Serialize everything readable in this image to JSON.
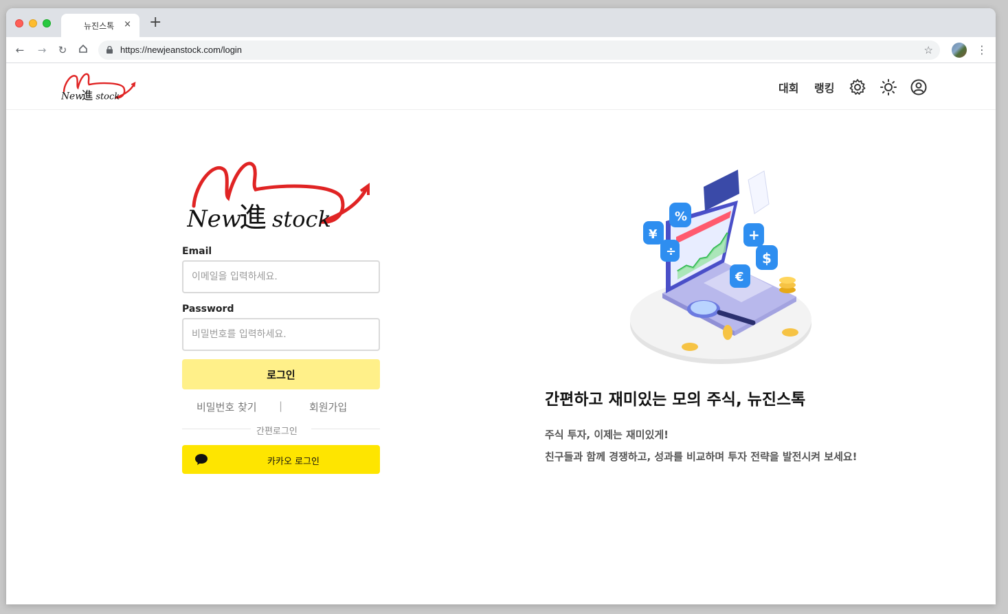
{
  "browser": {
    "tab_title": "뉴진스톡",
    "tab_close": "×",
    "new_tab": "+",
    "url": "https://newjeanstock.com/login"
  },
  "header": {
    "nav": [
      "대회",
      "랭킹"
    ],
    "icons": [
      "settings-icon",
      "theme-sun-icon",
      "account-icon"
    ]
  },
  "logo": {
    "text_new": "New",
    "text_hanja": "進",
    "text_stock": "stock"
  },
  "login": {
    "email_label": "Email",
    "email_placeholder": "이메일을 입력하세요.",
    "password_label": "Password",
    "password_placeholder": "비밀번호를 입력하세요.",
    "login_button": "로그인",
    "find_password": "비밀번호 찾기",
    "separator": "|",
    "signup": "회원가입",
    "easy_login": "간편로그인",
    "kakao_button": "카카오 로그인"
  },
  "hero": {
    "title": "간편하고 재미있는 모의 주식, 뉴진스톡",
    "desc_line1": "주식 투자, 이제는 재미있게!",
    "desc_line2": "친구들과 함께 경쟁하고, 성과를 비교하며 투자 전략을 발전시켜 보세요!"
  },
  "colors": {
    "login_button_bg": "#fff089",
    "kakao_bg": "#fee500",
    "logo_red": "#e02424"
  }
}
